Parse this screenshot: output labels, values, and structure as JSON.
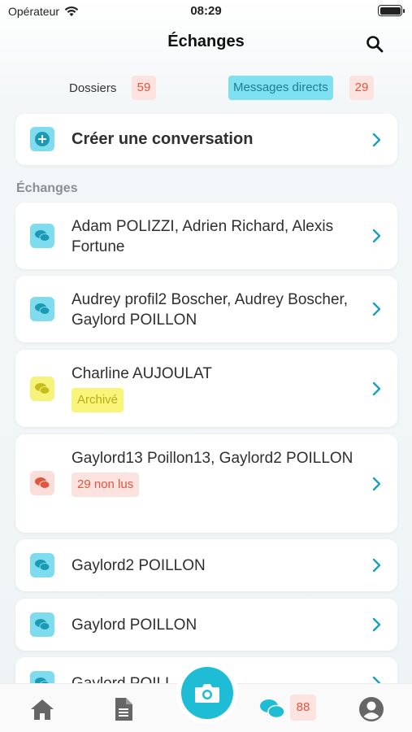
{
  "status_bar": {
    "carrier": "Opérateur",
    "time": "08:29"
  },
  "header": {
    "title": "Échanges"
  },
  "segments": {
    "folders_label": "Dossiers",
    "folders_count": "59",
    "direct_label": "Messages directs",
    "direct_count": "29"
  },
  "create": {
    "label": "Créer une conversation"
  },
  "section": {
    "label": "Échanges"
  },
  "conversations": [
    {
      "title": "Adam POLIZZI, Adrien Richard, Alexis Fortune"
    },
    {
      "title": "Audrey profil2 Boscher, Audrey Boscher, Gaylord POILLON"
    },
    {
      "title": "Charline AUJOULAT",
      "tag": "Archivé"
    },
    {
      "title": "Gaylord13 Poillon13, Gaylord2 POILLON",
      "tag": "29 non lus"
    },
    {
      "title": "Gaylord2 POILLON"
    },
    {
      "title": "Gaylord POILLON"
    },
    {
      "title": "Gaylord POILL"
    }
  ],
  "tabbar": {
    "messages_badge": "88"
  },
  "colors": {
    "accent": "#1fbcd6",
    "badge_bg": "#fde3df",
    "badge_text": "#e0553e",
    "archived_bg": "#f9f47a"
  }
}
